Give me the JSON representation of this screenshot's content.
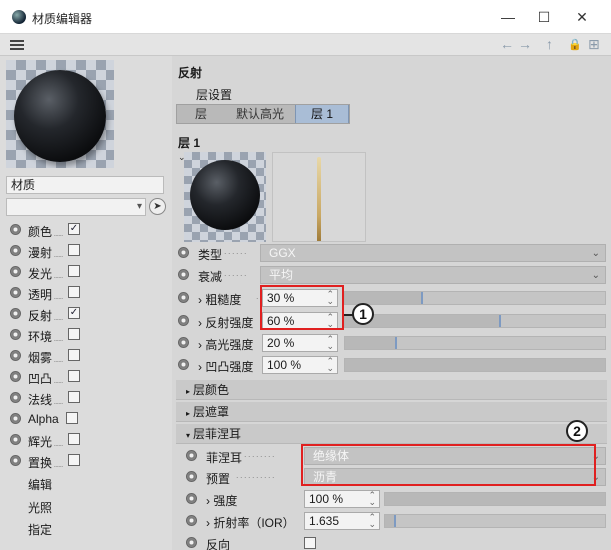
{
  "window": {
    "title": "材质编辑器",
    "icon": "cinema4d-icon",
    "minimize": "—",
    "maximize": "☐",
    "close": "✕"
  },
  "menubar": {
    "menu_icon": "hamburger-icon",
    "back": "←",
    "forward": "→",
    "up": "↑",
    "lock": "🔒",
    "new_window": "⊞"
  },
  "left": {
    "material_name": "材质",
    "channels": [
      {
        "label": "颜色",
        "checked": true,
        "check": "✓"
      },
      {
        "label": "漫射",
        "checked": false,
        "check": ""
      },
      {
        "label": "发光",
        "checked": false,
        "check": ""
      },
      {
        "label": "透明",
        "checked": false,
        "check": ""
      },
      {
        "label": "反射",
        "checked": true,
        "check": "✓"
      },
      {
        "label": "环境",
        "checked": false,
        "check": ""
      },
      {
        "label": "烟雾",
        "checked": false,
        "check": ""
      },
      {
        "label": "凹凸",
        "checked": false,
        "check": ""
      },
      {
        "label": "法线",
        "checked": false,
        "check": ""
      },
      {
        "label": "Alpha",
        "checked": false,
        "check": ""
      },
      {
        "label": "辉光",
        "checked": false,
        "check": ""
      },
      {
        "label": "置换",
        "checked": false,
        "check": ""
      }
    ],
    "extra_items": [
      "编辑",
      "光照",
      "指定"
    ]
  },
  "main": {
    "section_title": "反射",
    "layer_settings": "层设置",
    "tabs": [
      {
        "label": "层",
        "active": false
      },
      {
        "label": "默认高光",
        "active": false
      },
      {
        "label": "层 1",
        "active": true
      }
    ],
    "layer_title": "层 1",
    "type": {
      "label": "类型",
      "value": "GGX"
    },
    "attenuation": {
      "label": "衰减",
      "value": "平均"
    },
    "roughness": {
      "label": "粗糙度",
      "value": "30 %",
      "fraction": 0.3
    },
    "reflect_strength": {
      "label": "反射强度",
      "value": "60 %",
      "fraction": 0.6
    },
    "specular_strength": {
      "label": "高光强度",
      "value": "20 %",
      "fraction": 0.2
    },
    "bump_strength": {
      "label": "凹凸强度",
      "value": "100 %",
      "fraction": 1.0
    },
    "subsections": [
      "层颜色",
      "层遮罩",
      "层菲涅耳"
    ],
    "fresnel": {
      "label": "菲涅耳",
      "value": "绝缘体"
    },
    "preset": {
      "label": "预置",
      "value": "沥青"
    },
    "strength": {
      "label": "强度",
      "value": "100 %",
      "fraction": 1.0
    },
    "ior": {
      "label": "折射率（IOR）",
      "value": "1.635",
      "fraction": 0.05
    },
    "invert": {
      "label": "反向"
    },
    "arrow": "›"
  },
  "annotations": {
    "callout_1": "1",
    "callout_2": "2"
  },
  "colors": {
    "highlight_red": "#e02020",
    "active_tab": "#a9bdd6",
    "slider_marker": "#7d9ac2"
  }
}
